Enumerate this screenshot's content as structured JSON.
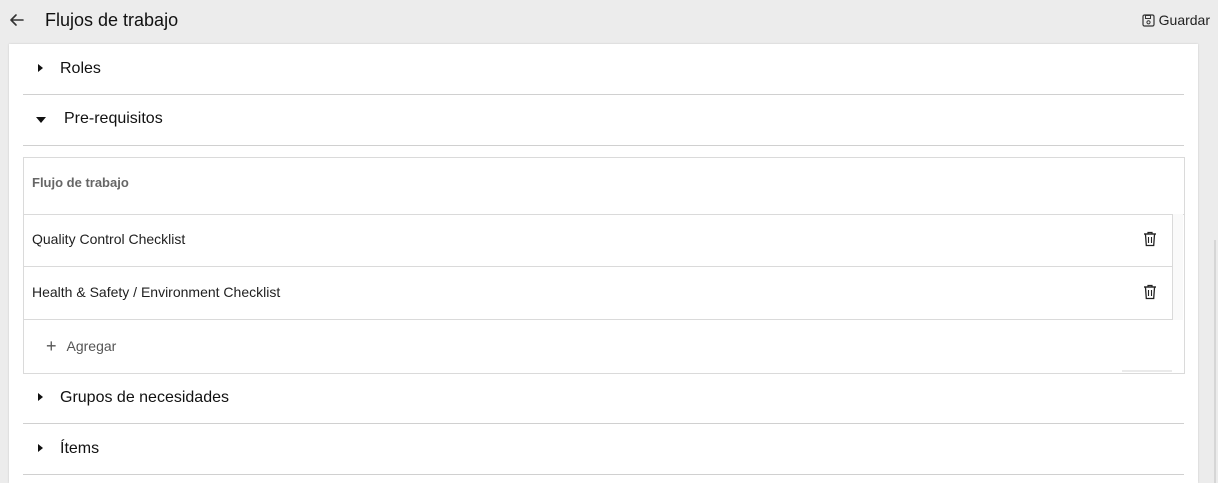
{
  "header": {
    "title": "Flujos de trabajo",
    "save_label": "Guardar"
  },
  "sections": [
    {
      "label": "Roles",
      "expanded": false
    },
    {
      "label": "Pre-requisitos",
      "expanded": true
    },
    {
      "label": "Grupos de necesidades",
      "expanded": false
    },
    {
      "label": "Ítems",
      "expanded": false
    }
  ],
  "prerequisites": {
    "column_header": "Flujo de trabajo",
    "rows": [
      "Quality Control Checklist",
      "Health & Safety / Environment Checklist"
    ],
    "add_label": "Agregar"
  }
}
